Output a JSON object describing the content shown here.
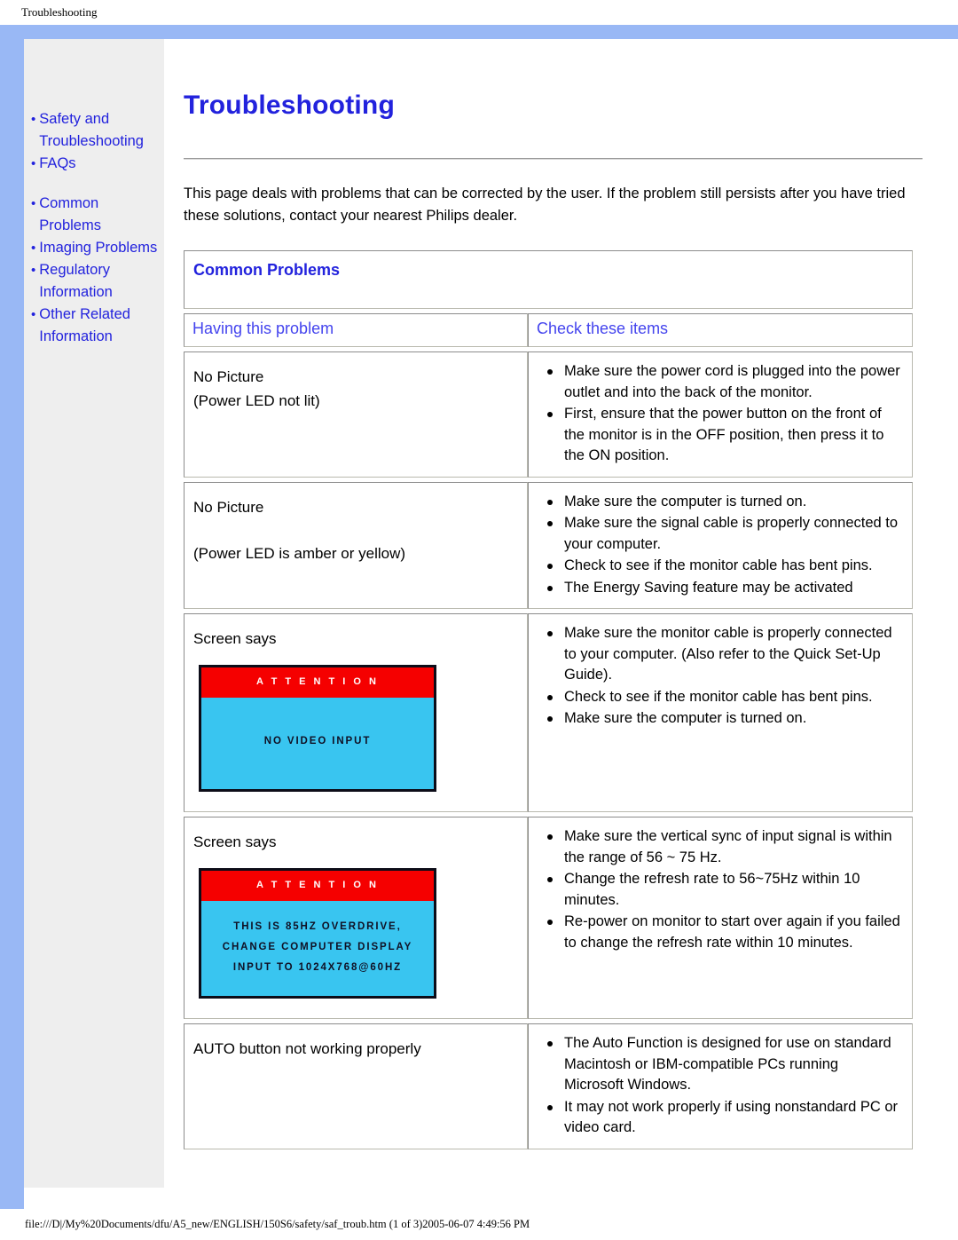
{
  "print_header": {
    "title": "Troubleshooting"
  },
  "print_footer": {
    "path": "file:///D|/My%20Documents/dfu/A5_new/ENGLISH/150S6/safety/saf_troub.htm (1 of 3)2005-06-07 4:49:56 PM"
  },
  "sidebar": {
    "groups": [
      {
        "items": [
          {
            "label": "Safety and Troubleshooting"
          },
          {
            "label": "FAQs"
          }
        ]
      },
      {
        "items": [
          {
            "label": "Common Problems"
          },
          {
            "label": "Imaging Problems"
          },
          {
            "label": "Regulatory Information"
          },
          {
            "label": "Other Related Information"
          }
        ]
      }
    ],
    "bullet": "•"
  },
  "main": {
    "title": "Troubleshooting",
    "intro": "This page deals with problems that can be corrected by the user. If the problem still persists after you have tried these solutions, contact your nearest Philips dealer.",
    "table": {
      "section_title": "Common Problems",
      "headers": {
        "left": "Having this problem",
        "right": "Check these items"
      },
      "rows": [
        {
          "problem_lines": [
            "No Picture",
            "(Power LED not lit)"
          ],
          "spaced": false,
          "checks": [
            "Make sure the power cord is plugged into the power outlet and into the back of the monitor.",
            "First, ensure that the power button on the front of the monitor is in the OFF position, then press it to the ON position."
          ]
        },
        {
          "problem_lines": [
            "No Picture",
            "(Power LED is amber or yellow)"
          ],
          "spaced": true,
          "checks": [
            "Make sure the computer is turned on.",
            "Make sure the signal cable is properly connected to your computer.",
            "Check to see if the monitor cable has bent pins.",
            "The Energy Saving feature may be activated"
          ]
        },
        {
          "problem_lines": [
            "Screen says"
          ],
          "spaced": false,
          "osd": {
            "attention": "A T T E N T I O N",
            "lines": [
              "NO VIDEO INPUT"
            ],
            "style": "tall"
          },
          "checks": [
            "Make sure the monitor cable is properly connected to your computer. (Also refer to the Quick Set-Up Guide).",
            "Check to see if the monitor cable has bent pins.",
            "Make sure the computer is turned on."
          ]
        },
        {
          "problem_lines": [
            "Screen says"
          ],
          "spaced": false,
          "osd": {
            "attention": "A T T E N T I O N",
            "lines": [
              "THIS IS 85HZ OVERDRIVE,",
              "CHANGE COMPUTER DISPLAY",
              "INPUT TO 1024X768@60HZ"
            ],
            "style": "multi"
          },
          "checks": [
            "Make sure the vertical sync of input signal is within the range of 56 ~ 75 Hz.",
            "Change the refresh rate to 56~75Hz within 10 minutes.",
            "Re-power on monitor to start over again if you failed to change the refresh rate within 10 minutes."
          ]
        },
        {
          "problem_lines": [
            "AUTO button not working properly"
          ],
          "spaced": false,
          "checks": [
            "The Auto Function is designed for use on standard Macintosh or IBM-compatible PCs running Microsoft Windows.",
            "It may not work properly if using nonstandard PC or video card."
          ]
        }
      ]
    }
  },
  "colors": {
    "page_border": "#99b8f5",
    "sidebar_bg": "#eeeeee",
    "link_blue": "#2222dd",
    "heading_blue": "#4444ee",
    "osd_bar_red": "#f50000",
    "osd_bg_cyan": "#39c5f0"
  }
}
